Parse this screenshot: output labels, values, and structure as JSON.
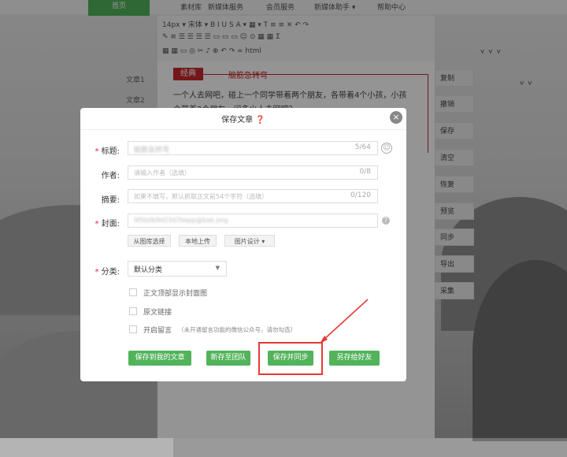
{
  "nav": {
    "home": "首页",
    "items": [
      "素材库",
      "新媒体服务",
      "会员服务",
      "新媒体助手 ▾",
      "帮助中心"
    ]
  },
  "toolbar": {
    "row1": "14px ▾  宋体 ▾  B  I  U  S  A ▾  ▦ ▾  T  ≡  ≡  ✕  ↶  ↷",
    "row2": "✎  ≡  ☰  ☰  ☰  ☰  ▭  ▭  ▭  ☺  ⊙  ▦  ▦  Σ",
    "row3": "▦  ▦  ▭  ◎  ✂  ♪  ⊕  ↶  ↷  ∞  html"
  },
  "editor": {
    "tag": "经典",
    "tag_title": "脑筋急转弯",
    "body_line1": "一个人去网吧，碰上一个同学带着两个朋友，各带着4个小孩，小孩",
    "body_line2": "个带着2个朋友，问多少人去网吧？"
  },
  "docs": [
    "文章1",
    "文章2"
  ],
  "side_panel": [
    "复制",
    "撤销",
    "保存",
    "清空",
    "恢复",
    "预览",
    "同步",
    "导出",
    "采集"
  ],
  "modal": {
    "title": "保存文章 ❓",
    "close": "×",
    "title_label": "标题:",
    "title_value": "脑筋急转弯",
    "title_count": "5/64",
    "author_label": "作者:",
    "author_placeholder": "请输入作者（选填）",
    "author_count": "0/8",
    "summary_label": "摘要:",
    "summary_placeholder": "如果不填写，默认抓取正文前54个字符（选填）",
    "summary_count": "0/120",
    "cover_label": "封面:",
    "cover_value": "9f5b0b9d23d7bepp@bab.png",
    "cover_btn_library": "从图库选择",
    "cover_btn_upload": "本地上传",
    "cover_btn_design": "图片设计 ▾",
    "category_label": "分类:",
    "category_value": "默认分类",
    "check_cover": "正文顶部显示封面图",
    "check_link": "原文链接",
    "check_comment": "开启留言",
    "check_comment_note": "（未开通留言功能的微信公众号，请勿勾选）",
    "btn_save_mine": "保存到我的文章",
    "btn_save_team": "新存至团队",
    "btn_save_sync": "保存并同步",
    "btn_save_friend": "另存给好友"
  },
  "colors": {
    "accent": "#52b35b",
    "highlight": "#e53935",
    "tag": "#c8282e"
  }
}
